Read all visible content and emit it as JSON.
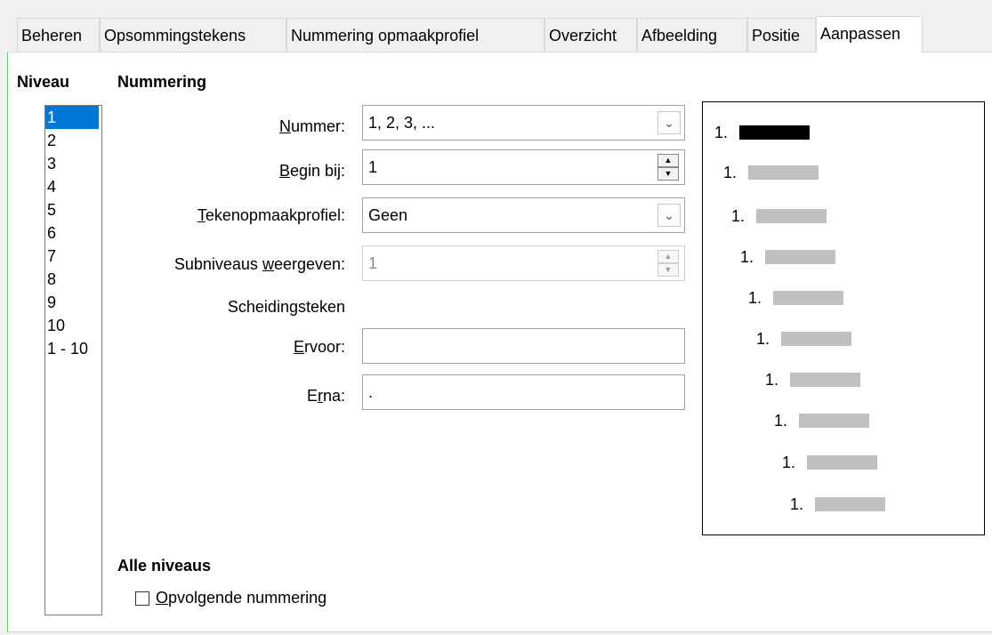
{
  "tabs": [
    {
      "label": "Beheren",
      "active": false
    },
    {
      "label": "Opsommingstekens",
      "active": false
    },
    {
      "label": "Nummering opmaakprofiel",
      "active": false
    },
    {
      "label": "Overzicht",
      "active": false
    },
    {
      "label": "Afbeelding",
      "active": false
    },
    {
      "label": "Positie",
      "active": false
    },
    {
      "label": "Aanpassen",
      "active": true
    }
  ],
  "level": {
    "heading": "Niveau",
    "items": [
      "1",
      "2",
      "3",
      "4",
      "5",
      "6",
      "7",
      "8",
      "9",
      "10",
      "1 - 10"
    ],
    "selected": "1"
  },
  "numbering": {
    "heading": "Nummering",
    "number_label_u": "N",
    "number_label_rest": "ummer:",
    "number_value": "1, 2, 3, ...",
    "start_label_u": "B",
    "start_label_rest": "egin bij:",
    "start_value": "1",
    "char_style_label_u": "T",
    "char_style_label_rest": "ekenopmaakprofiel:",
    "char_style_value": "Geen",
    "sublevels_label_pre": "Subniveaus ",
    "sublevels_label_u": "w",
    "sublevels_label_rest": "eergeven:",
    "sublevels_value": "1",
    "separator_heading": "Scheidingsteken",
    "before_label_u": "E",
    "before_label_rest": "rvoor:",
    "before_value": "",
    "after_label_pre": "E",
    "after_label_u": "r",
    "after_label_rest": "na:",
    "after_value": "."
  },
  "preview": {
    "rows": [
      "1.",
      "1.",
      "1.",
      "1.",
      "1.",
      "1.",
      "1.",
      "1.",
      "1.",
      "1."
    ]
  },
  "all_levels": {
    "heading": "Alle niveaus",
    "consecutive_label_u": "O",
    "consecutive_label_rest": "pvolgende nummering",
    "consecutive_checked": false
  },
  "colors": {
    "selection": "#0078d7",
    "panel_border": "#6fc06f"
  }
}
